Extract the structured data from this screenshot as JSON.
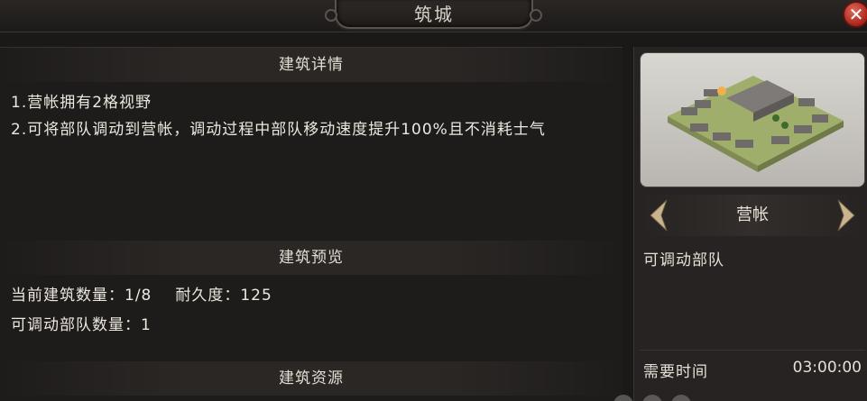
{
  "window": {
    "title": "筑城"
  },
  "details": {
    "heading": "建筑详情",
    "lines": [
      "1.营帐拥有2格视野",
      "2.可将部队调动到营帐，调动过程中部队移动速度提升100%且不消耗士气"
    ]
  },
  "preview": {
    "heading": "建筑预览",
    "count_label": "当前建筑数量：",
    "count_value": "1/8",
    "durability_label": "耐久度：",
    "durability_value": "125",
    "troops_label": "可调动部队数量：",
    "troops_value": "1"
  },
  "resources": {
    "heading": "建筑资源"
  },
  "building": {
    "name": "营帐",
    "description": "可调动部队",
    "time_label": "需要时间",
    "time_value": "03:00:00"
  },
  "colors": {
    "accent": "#c9a86a",
    "close": "#b8342a"
  },
  "icons": [
    "close-icon",
    "arrow-left-icon",
    "arrow-right-icon"
  ]
}
